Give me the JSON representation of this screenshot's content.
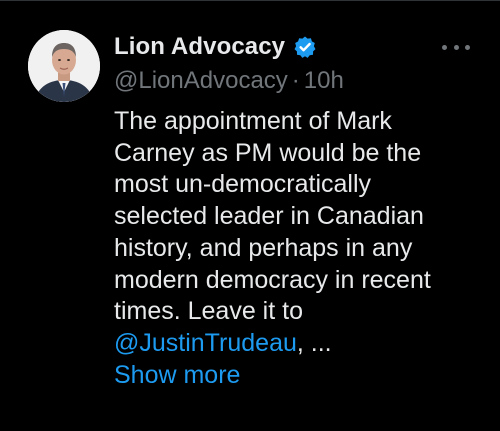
{
  "author": {
    "display_name": "Lion Advocacy",
    "handle": "@LionAdvocacy",
    "separator": "·",
    "time": "10h",
    "verified": true
  },
  "post": {
    "lines": [
      "The appointment of Mark",
      "Carney as PM would be the",
      "most un-democratically",
      "selected leader in Canadian",
      "history, and perhaps in any",
      "modern democracy in recent",
      "times. Leave it to"
    ],
    "mention": "@JustinTrudeau",
    "mention_suffix": ", ...",
    "show_more_label": "Show more"
  },
  "icons": {
    "verified": "verified-badge-icon",
    "more": "more-options-icon"
  },
  "colors": {
    "background": "#000000",
    "text": "#e7e9ea",
    "secondary": "#71767b",
    "link": "#1d9bf0"
  }
}
